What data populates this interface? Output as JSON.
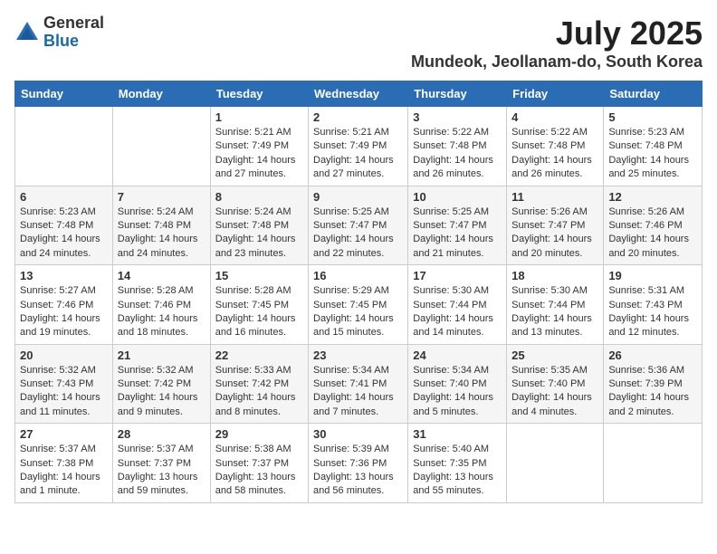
{
  "logo": {
    "general": "General",
    "blue": "Blue"
  },
  "header": {
    "month": "July 2025",
    "location": "Mundeok, Jeollanam-do, South Korea"
  },
  "weekdays": [
    "Sunday",
    "Monday",
    "Tuesday",
    "Wednesday",
    "Thursday",
    "Friday",
    "Saturday"
  ],
  "weeks": [
    [
      {
        "day": "",
        "sunrise": "",
        "sunset": "",
        "daylight": ""
      },
      {
        "day": "",
        "sunrise": "",
        "sunset": "",
        "daylight": ""
      },
      {
        "day": "1",
        "sunrise": "Sunrise: 5:21 AM",
        "sunset": "Sunset: 7:49 PM",
        "daylight": "Daylight: 14 hours and 27 minutes."
      },
      {
        "day": "2",
        "sunrise": "Sunrise: 5:21 AM",
        "sunset": "Sunset: 7:49 PM",
        "daylight": "Daylight: 14 hours and 27 minutes."
      },
      {
        "day": "3",
        "sunrise": "Sunrise: 5:22 AM",
        "sunset": "Sunset: 7:48 PM",
        "daylight": "Daylight: 14 hours and 26 minutes."
      },
      {
        "day": "4",
        "sunrise": "Sunrise: 5:22 AM",
        "sunset": "Sunset: 7:48 PM",
        "daylight": "Daylight: 14 hours and 26 minutes."
      },
      {
        "day": "5",
        "sunrise": "Sunrise: 5:23 AM",
        "sunset": "Sunset: 7:48 PM",
        "daylight": "Daylight: 14 hours and 25 minutes."
      }
    ],
    [
      {
        "day": "6",
        "sunrise": "Sunrise: 5:23 AM",
        "sunset": "Sunset: 7:48 PM",
        "daylight": "Daylight: 14 hours and 24 minutes."
      },
      {
        "day": "7",
        "sunrise": "Sunrise: 5:24 AM",
        "sunset": "Sunset: 7:48 PM",
        "daylight": "Daylight: 14 hours and 24 minutes."
      },
      {
        "day": "8",
        "sunrise": "Sunrise: 5:24 AM",
        "sunset": "Sunset: 7:48 PM",
        "daylight": "Daylight: 14 hours and 23 minutes."
      },
      {
        "day": "9",
        "sunrise": "Sunrise: 5:25 AM",
        "sunset": "Sunset: 7:47 PM",
        "daylight": "Daylight: 14 hours and 22 minutes."
      },
      {
        "day": "10",
        "sunrise": "Sunrise: 5:25 AM",
        "sunset": "Sunset: 7:47 PM",
        "daylight": "Daylight: 14 hours and 21 minutes."
      },
      {
        "day": "11",
        "sunrise": "Sunrise: 5:26 AM",
        "sunset": "Sunset: 7:47 PM",
        "daylight": "Daylight: 14 hours and 20 minutes."
      },
      {
        "day": "12",
        "sunrise": "Sunrise: 5:26 AM",
        "sunset": "Sunset: 7:46 PM",
        "daylight": "Daylight: 14 hours and 20 minutes."
      }
    ],
    [
      {
        "day": "13",
        "sunrise": "Sunrise: 5:27 AM",
        "sunset": "Sunset: 7:46 PM",
        "daylight": "Daylight: 14 hours and 19 minutes."
      },
      {
        "day": "14",
        "sunrise": "Sunrise: 5:28 AM",
        "sunset": "Sunset: 7:46 PM",
        "daylight": "Daylight: 14 hours and 18 minutes."
      },
      {
        "day": "15",
        "sunrise": "Sunrise: 5:28 AM",
        "sunset": "Sunset: 7:45 PM",
        "daylight": "Daylight: 14 hours and 16 minutes."
      },
      {
        "day": "16",
        "sunrise": "Sunrise: 5:29 AM",
        "sunset": "Sunset: 7:45 PM",
        "daylight": "Daylight: 14 hours and 15 minutes."
      },
      {
        "day": "17",
        "sunrise": "Sunrise: 5:30 AM",
        "sunset": "Sunset: 7:44 PM",
        "daylight": "Daylight: 14 hours and 14 minutes."
      },
      {
        "day": "18",
        "sunrise": "Sunrise: 5:30 AM",
        "sunset": "Sunset: 7:44 PM",
        "daylight": "Daylight: 14 hours and 13 minutes."
      },
      {
        "day": "19",
        "sunrise": "Sunrise: 5:31 AM",
        "sunset": "Sunset: 7:43 PM",
        "daylight": "Daylight: 14 hours and 12 minutes."
      }
    ],
    [
      {
        "day": "20",
        "sunrise": "Sunrise: 5:32 AM",
        "sunset": "Sunset: 7:43 PM",
        "daylight": "Daylight: 14 hours and 11 minutes."
      },
      {
        "day": "21",
        "sunrise": "Sunrise: 5:32 AM",
        "sunset": "Sunset: 7:42 PM",
        "daylight": "Daylight: 14 hours and 9 minutes."
      },
      {
        "day": "22",
        "sunrise": "Sunrise: 5:33 AM",
        "sunset": "Sunset: 7:42 PM",
        "daylight": "Daylight: 14 hours and 8 minutes."
      },
      {
        "day": "23",
        "sunrise": "Sunrise: 5:34 AM",
        "sunset": "Sunset: 7:41 PM",
        "daylight": "Daylight: 14 hours and 7 minutes."
      },
      {
        "day": "24",
        "sunrise": "Sunrise: 5:34 AM",
        "sunset": "Sunset: 7:40 PM",
        "daylight": "Daylight: 14 hours and 5 minutes."
      },
      {
        "day": "25",
        "sunrise": "Sunrise: 5:35 AM",
        "sunset": "Sunset: 7:40 PM",
        "daylight": "Daylight: 14 hours and 4 minutes."
      },
      {
        "day": "26",
        "sunrise": "Sunrise: 5:36 AM",
        "sunset": "Sunset: 7:39 PM",
        "daylight": "Daylight: 14 hours and 2 minutes."
      }
    ],
    [
      {
        "day": "27",
        "sunrise": "Sunrise: 5:37 AM",
        "sunset": "Sunset: 7:38 PM",
        "daylight": "Daylight: 14 hours and 1 minute."
      },
      {
        "day": "28",
        "sunrise": "Sunrise: 5:37 AM",
        "sunset": "Sunset: 7:37 PM",
        "daylight": "Daylight: 13 hours and 59 minutes."
      },
      {
        "day": "29",
        "sunrise": "Sunrise: 5:38 AM",
        "sunset": "Sunset: 7:37 PM",
        "daylight": "Daylight: 13 hours and 58 minutes."
      },
      {
        "day": "30",
        "sunrise": "Sunrise: 5:39 AM",
        "sunset": "Sunset: 7:36 PM",
        "daylight": "Daylight: 13 hours and 56 minutes."
      },
      {
        "day": "31",
        "sunrise": "Sunrise: 5:40 AM",
        "sunset": "Sunset: 7:35 PM",
        "daylight": "Daylight: 13 hours and 55 minutes."
      },
      {
        "day": "",
        "sunrise": "",
        "sunset": "",
        "daylight": ""
      },
      {
        "day": "",
        "sunrise": "",
        "sunset": "",
        "daylight": ""
      }
    ]
  ]
}
